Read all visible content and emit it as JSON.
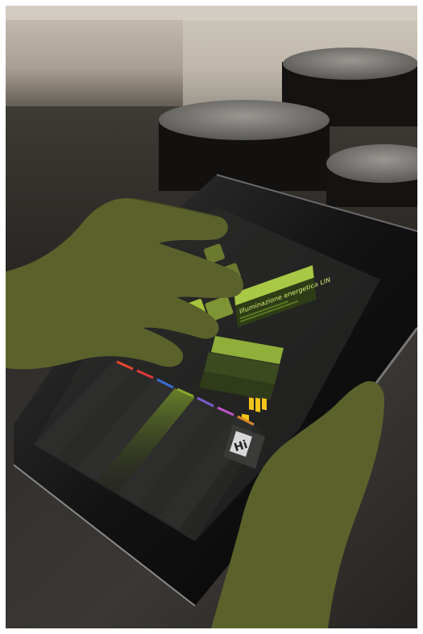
{
  "photo": {
    "description_colors": {
      "hand": "#5b612b",
      "hand_edge": "#4a5024",
      "accent_green": "#b5d64a",
      "accent_yellow": "#f2c31a",
      "screen_bg": "#232322",
      "wall": "#b8afa4",
      "table": "#2a2826"
    }
  },
  "screen": {
    "panel_title": "Illuminazione energetica LIN",
    "badge_text": "Hi"
  },
  "columns": {
    "colors": [
      "#e8462c",
      "#e03a3a",
      "#3a6bd1",
      "#8aa62e",
      "#7a5cc8",
      "#c054c8",
      "#d98a2a",
      "#c8c8c8"
    ]
  }
}
